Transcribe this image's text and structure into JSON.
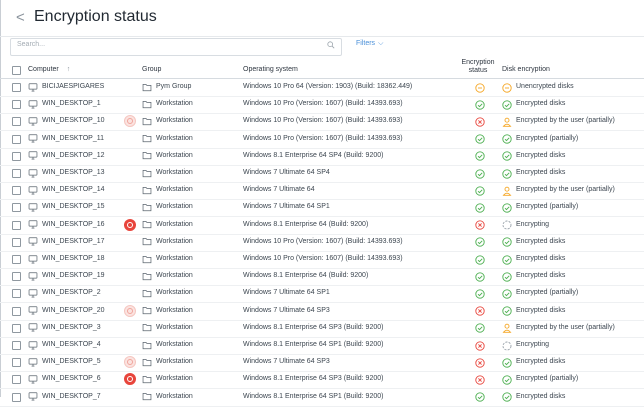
{
  "header": {
    "back_glyph": "<",
    "title": "Encryption status"
  },
  "search": {
    "placeholder": "Search...",
    "filters_label": "Filters"
  },
  "columns": {
    "computer": "Computer",
    "group": "Group",
    "os": "Operating system",
    "status_line1": "Encryption",
    "status_line2": "status",
    "disk": "Disk encryption",
    "sort_glyph": "↑"
  },
  "colors": {
    "ok": "#4caf50",
    "fail": "#e8453c",
    "warn": "#f5a623",
    "user": "#f5a623",
    "neutral": "#9aa3ab",
    "accent": "#4a90d9"
  },
  "rows": [
    {
      "computer": "BICIJAESPIGARES",
      "group": "Pym Group",
      "os": "Windows 10 Pro 64 (Version: 1903) (Build: 18362.449)",
      "status": "warn",
      "disk_icon": "warn",
      "disk": "Unencrypted disks",
      "alert": "none"
    },
    {
      "computer": "WIN_DESKTOP_1",
      "group": "Workstation",
      "os": "Windows 10 Pro (Version: 1607) (Build: 14393.693)",
      "status": "ok",
      "disk_icon": "ok",
      "disk": "Encrypted disks",
      "alert": "none"
    },
    {
      "computer": "WIN_DESKTOP_10",
      "group": "Workstation",
      "os": "Windows 10 Pro (Version: 1607) (Build: 14393.693)",
      "status": "fail",
      "disk_icon": "user",
      "disk": "Encrypted by the user (partially)",
      "alert": "light"
    },
    {
      "computer": "WIN_DESKTOP_11",
      "group": "Workstation",
      "os": "Windows 10 Pro (Version: 1607) (Build: 14393.693)",
      "status": "ok",
      "disk_icon": "ok",
      "disk": "Encrypted (partially)",
      "alert": "none"
    },
    {
      "computer": "WIN_DESKTOP_12",
      "group": "Workstation",
      "os": "Windows 8.1 Enterprise 64 SP4 (Build: 9200)",
      "status": "ok",
      "disk_icon": "ok",
      "disk": "Encrypted disks",
      "alert": "none"
    },
    {
      "computer": "WIN_DESKTOP_13",
      "group": "Workstation",
      "os": "Windows 7 Ultimate 64 SP4",
      "status": "ok",
      "disk_icon": "ok",
      "disk": "Encrypted disks",
      "alert": "none"
    },
    {
      "computer": "WIN_DESKTOP_14",
      "group": "Workstation",
      "os": "Windows 7 Ultimate 64",
      "status": "ok",
      "disk_icon": "user",
      "disk": "Encrypted by the user (partially)",
      "alert": "none"
    },
    {
      "computer": "WIN_DESKTOP_15",
      "group": "Workstation",
      "os": "Windows 7 Ultimate 64 SP1",
      "status": "ok",
      "disk_icon": "ok",
      "disk": "Encrypted (partially)",
      "alert": "none"
    },
    {
      "computer": "WIN_DESKTOP_16",
      "group": "Workstation",
      "os": "Windows 8.1 Enterprise 64 (Build: 9200)",
      "status": "fail",
      "disk_icon": "encrypting",
      "disk": "Encrypting",
      "alert": "strong"
    },
    {
      "computer": "WIN_DESKTOP_17",
      "group": "Workstation",
      "os": "Windows 10 Pro (Version: 1607) (Build: 14393.693)",
      "status": "ok",
      "disk_icon": "ok",
      "disk": "Encrypted disks",
      "alert": "none"
    },
    {
      "computer": "WIN_DESKTOP_18",
      "group": "Workstation",
      "os": "Windows 10 Pro (Version: 1607) (Build: 14393.693)",
      "status": "ok",
      "disk_icon": "ok",
      "disk": "Encrypted disks",
      "alert": "none"
    },
    {
      "computer": "WIN_DESKTOP_19",
      "group": "Workstation",
      "os": "Windows 8.1 Enterprise 64 (Build: 9200)",
      "status": "ok",
      "disk_icon": "ok",
      "disk": "Encrypted disks",
      "alert": "none"
    },
    {
      "computer": "WIN_DESKTOP_2",
      "group": "Workstation",
      "os": "Windows 7 Ultimate 64 SP1",
      "status": "ok",
      "disk_icon": "ok",
      "disk": "Encrypted (partially)",
      "alert": "none"
    },
    {
      "computer": "WIN_DESKTOP_20",
      "group": "Workstation",
      "os": "Windows 7 Ultimate 64 SP3",
      "status": "fail",
      "disk_icon": "ok",
      "disk": "Encrypted disks",
      "alert": "light"
    },
    {
      "computer": "WIN_DESKTOP_3",
      "group": "Workstation",
      "os": "Windows 8.1 Enterprise 64 SP3 (Build: 9200)",
      "status": "ok",
      "disk_icon": "user",
      "disk": "Encrypted by the user (partially)",
      "alert": "none"
    },
    {
      "computer": "WIN_DESKTOP_4",
      "group": "Workstation",
      "os": "Windows 8.1 Enterprise 64 SP1 (Build: 9200)",
      "status": "fail",
      "disk_icon": "encrypting",
      "disk": "Encrypting",
      "alert": "none"
    },
    {
      "computer": "WIN_DESKTOP_5",
      "group": "Workstation",
      "os": "Windows 7 Ultimate 64 SP3",
      "status": "fail",
      "disk_icon": "ok",
      "disk": "Encrypted disks",
      "alert": "light"
    },
    {
      "computer": "WIN_DESKTOP_6",
      "group": "Workstation",
      "os": "Windows 8.1 Enterprise 64 SP3 (Build: 9200)",
      "status": "fail",
      "disk_icon": "ok",
      "disk": "Encrypted (partially)",
      "alert": "strong"
    },
    {
      "computer": "WIN_DESKTOP_7",
      "group": "Workstation",
      "os": "Windows 8.1 Enterprise 64 SP1 (Build: 9200)",
      "status": "ok",
      "disk_icon": "ok",
      "disk": "Encrypted disks",
      "alert": "none"
    }
  ]
}
